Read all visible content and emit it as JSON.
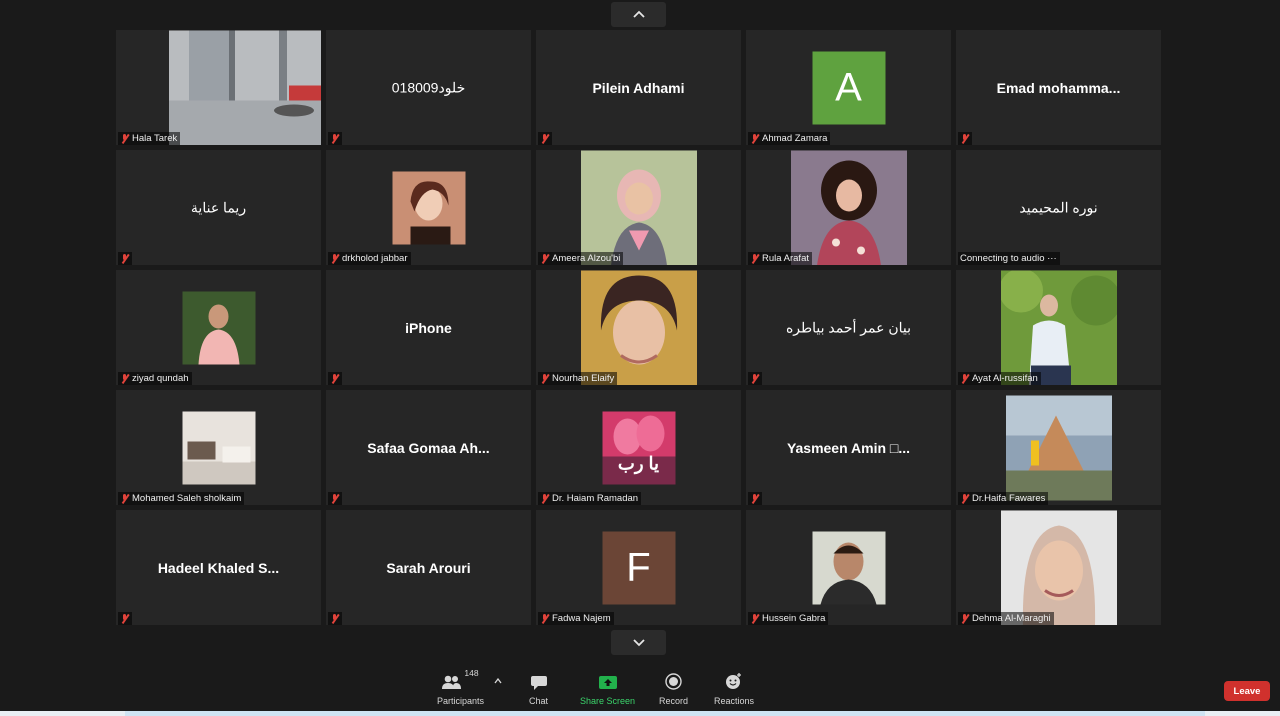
{
  "nav": {
    "up_icon": "chevron-up-icon",
    "down_icon": "chevron-down-icon"
  },
  "tiles": [
    {
      "label": "Hala Tarek",
      "type": "photo"
    },
    {
      "label": "",
      "name": "خلود018009",
      "type": "name"
    },
    {
      "label": "",
      "name": "Pilein Adhami",
      "type": "name"
    },
    {
      "label": "Ahmad Zamara",
      "letter": "A",
      "type": "letter",
      "color": "#5fa23f"
    },
    {
      "label": "",
      "name": "Emad  mohamma...",
      "type": "name"
    },
    {
      "label": "",
      "name": "ريما عناية",
      "type": "name"
    },
    {
      "label": "drkholod jabbar",
      "type": "photo"
    },
    {
      "label": "Ameera Alzou'bi",
      "type": "photo"
    },
    {
      "label": "Rula Arafat",
      "type": "photo"
    },
    {
      "label": "Connecting to audio ···",
      "name": "نوره المحيميد",
      "type": "name"
    },
    {
      "label": "ziyad qundah",
      "type": "photo"
    },
    {
      "label": "",
      "name": "iPhone",
      "type": "name"
    },
    {
      "label": "Nourhan Elaify",
      "type": "photo"
    },
    {
      "label": "",
      "name": "بيان عمر أحمد بياطره",
      "type": "name"
    },
    {
      "label": "Ayat Al-russifan",
      "type": "photo"
    },
    {
      "label": "Mohamed Saleh sholkaim",
      "type": "photo"
    },
    {
      "label": "",
      "name": "Safaa  Gomaa  Ah...",
      "type": "name"
    },
    {
      "label": "Dr. Haiam Ramadan",
      "type": "photo",
      "overlay": "يا رب"
    },
    {
      "label": "",
      "name": "Yasmeen  Amin □...",
      "type": "name"
    },
    {
      "label": "Dr.Haifa Fawares",
      "type": "photo"
    },
    {
      "label": "",
      "name": "Hadeel  Khaled  S...",
      "type": "name"
    },
    {
      "label": "",
      "name": "Sarah Arouri",
      "type": "name"
    },
    {
      "label": "Fadwa Najem",
      "letter": "F",
      "type": "letter",
      "color": "#6b4536"
    },
    {
      "label": "Hussein Gabra",
      "type": "photo"
    },
    {
      "label": "Dehma Al-Maraghi",
      "type": "photo"
    }
  ],
  "toolbar": {
    "participants_label": "Participants",
    "participants_count": "148",
    "chat_label": "Chat",
    "share_label": "Share Screen",
    "record_label": "Record",
    "reactions_label": "Reactions",
    "leave_label": "Leave"
  },
  "colors": {
    "leave": "#d0312d",
    "share": "#22b14c",
    "mute": "#e0433b"
  }
}
